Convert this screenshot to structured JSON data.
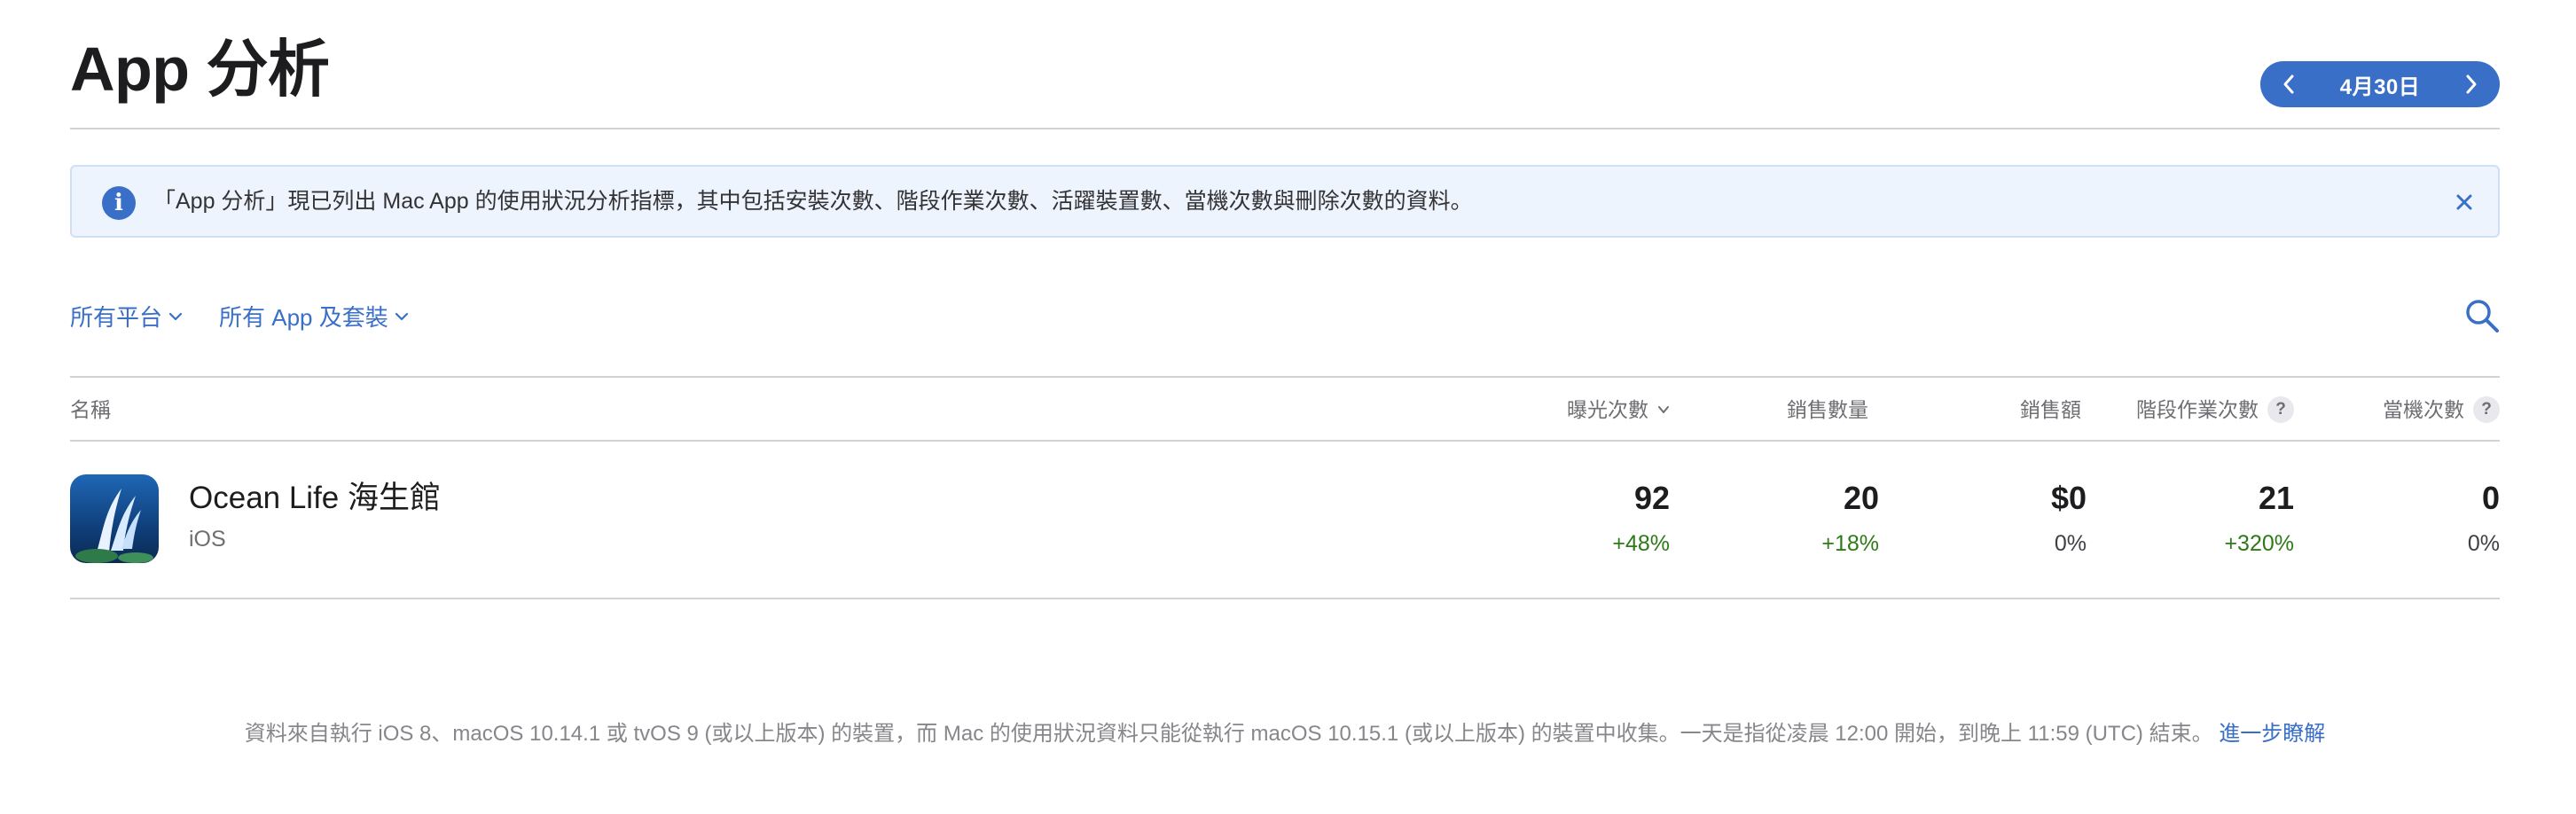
{
  "header": {
    "title": "App 分析",
    "date": "4月30日"
  },
  "banner": {
    "message": "「App 分析」現已列出 Mac App 的使用狀況分析指標，其中包括安裝次數、階段作業次數、活躍裝置數、當機次數與刪除次數的資料。"
  },
  "filters": {
    "platform": "所有平台",
    "apps": "所有 App 及套裝"
  },
  "table": {
    "columns": {
      "name": "名稱",
      "impressions": "曝光次數",
      "units": "銷售數量",
      "proceeds": "銷售額",
      "sessions": "階段作業次數",
      "crashes": "當機次數"
    },
    "help_mark": "?",
    "rows": [
      {
        "name": "Ocean Life 海生館",
        "platform": "iOS",
        "impressions": "92",
        "impressions_change": "+48%",
        "units": "20",
        "units_change": "+18%",
        "proceeds": "$0",
        "proceeds_change": "0%",
        "sessions": "21",
        "sessions_change": "+320%",
        "crashes": "0",
        "crashes_change": "0%"
      }
    ]
  },
  "footer": {
    "note": "資料來自執行 iOS 8、macOS 10.14.1 或 tvOS 9 (或以上版本) 的裝置，而 Mac 的使用狀況資料只能從執行 macOS 10.15.1 (或以上版本) 的裝置中收集。一天是指從凌晨 12:00 開始，到晚上 11:59 (UTC) 結束。",
    "link": "進一步瞭解"
  },
  "colors": {
    "accent": "#3a6fc8",
    "positive": "#2d7a16",
    "banner_bg": "#edf4fd"
  },
  "icons": [
    "chevron-left-icon",
    "chevron-right-icon",
    "info-icon",
    "close-icon",
    "chevron-down-icon",
    "search-icon",
    "sort-down-icon",
    "help-icon"
  ]
}
